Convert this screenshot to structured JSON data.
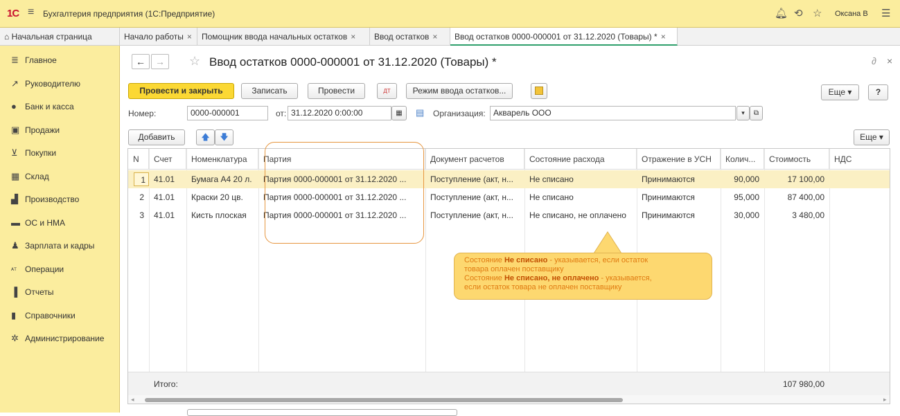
{
  "app": {
    "logo": "1С",
    "title": "Бухгалтерия предприятия (1С:Предприятие)",
    "user": "Оксана В"
  },
  "tabs": [
    {
      "label": "Начальная страница",
      "closable": false,
      "active": false
    },
    {
      "label": "Начало работы",
      "closable": true,
      "active": false
    },
    {
      "label": "Помощник ввода начальных остатков",
      "closable": true,
      "active": false
    },
    {
      "label": "Ввод остатков",
      "closable": true,
      "active": false
    },
    {
      "label": "Ввод остатков 0000-000001 от 31.12.2020 (Товары) *",
      "closable": true,
      "active": true
    }
  ],
  "sidebar": {
    "items": [
      {
        "label": "Главное",
        "icon": "menu-icon"
      },
      {
        "label": "Руководителю",
        "icon": "trend-icon"
      },
      {
        "label": "Банк и касса",
        "icon": "coin-icon"
      },
      {
        "label": "Продажи",
        "icon": "bag-icon"
      },
      {
        "label": "Покупки",
        "icon": "cart-icon"
      },
      {
        "label": "Склад",
        "icon": "warehouse-icon"
      },
      {
        "label": "Производство",
        "icon": "factory-icon"
      },
      {
        "label": "ОС и НМА",
        "icon": "truck-icon"
      },
      {
        "label": "Зарплата и кадры",
        "icon": "person-icon"
      },
      {
        "label": "Операции",
        "icon": "dt-kt-icon"
      },
      {
        "label": "Отчеты",
        "icon": "bar-chart-icon"
      },
      {
        "label": "Справочники",
        "icon": "book-icon"
      },
      {
        "label": "Администрирование",
        "icon": "gear-icon"
      }
    ]
  },
  "document": {
    "title": "Ввод остатков 0000-000001 от 31.12.2020 (Товары) *"
  },
  "toolbar": {
    "post_close": "Провести и закрыть",
    "save": "Записать",
    "post": "Провести",
    "mode": "Режим ввода остатков...",
    "more": "Еще",
    "help": "?"
  },
  "form": {
    "number_label": "Номер:",
    "number_value": "0000-000001",
    "date_label": "от:",
    "date_value": "31.12.2020  0:00:00",
    "org_label": "Организация:",
    "org_value": "Акварель ООО"
  },
  "table_toolbar": {
    "add": "Добавить",
    "more": "Еще"
  },
  "table": {
    "columns": [
      "N",
      "Счет",
      "Номенклатура",
      "Партия",
      "Документ расчетов",
      "Состояние расхода",
      "Отражение в УСН",
      "Колич...",
      "Стоимость",
      "НДС"
    ],
    "rows": [
      [
        "1",
        "41.01",
        "Бумага А4 20 л.",
        "Партия 0000-000001 от 31.12.2020 ...",
        "Поступление (акт, н...",
        "Не списано",
        "Принимаются",
        "90,000",
        "17 100,00",
        ""
      ],
      [
        "2",
        "41.01",
        "Краски 20 цв.",
        "Партия 0000-000001 от 31.12.2020 ...",
        "Поступление (акт, н...",
        "Не списано",
        "Принимаются",
        "95,000",
        "87 400,00",
        ""
      ],
      [
        "3",
        "41.01",
        "Кисть плоская",
        "Партия 0000-000001 от 31.12.2020 ...",
        "Поступление (акт, н...",
        "Не списано, не оплачено",
        "Принимаются",
        "30,000",
        "3 480,00",
        ""
      ]
    ],
    "total_label": "Итого:",
    "total_value": "107 980,00"
  },
  "callout": {
    "l1_pre": "Состояние ",
    "l1_bold": "Не списано",
    "l1_post": " - указывается, если остаток",
    "l2": "товара оплачен поставщику",
    "l3_pre": "Состояние ",
    "l3_bold": "Не списано, не оплачено",
    "l3_post": " - указывается,",
    "l4": "если остаток товара не оплачен поставщику"
  },
  "colors": {
    "sidebar_bg": "#fbed9e",
    "primary_button": "#fbd834",
    "selected_row": "#fbf0c4",
    "callout_bg": "#fdd870",
    "highlight_outline": "#e6953e"
  }
}
